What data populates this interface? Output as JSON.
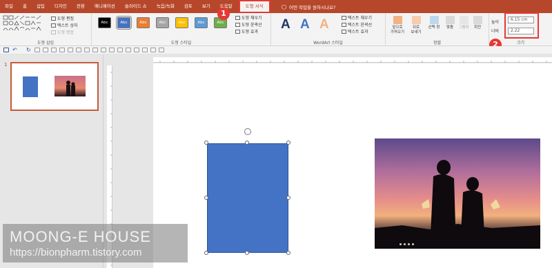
{
  "tabs": [
    "파일",
    "홈",
    "삽입",
    "디자인",
    "전환",
    "애니메이션",
    "슬라이드 쇼",
    "녹음/녹화",
    "검토",
    "보기",
    "도움말",
    "도형 서식"
  ],
  "active_tab": "도형 서식",
  "tell_me": "어떤 작업을 원하시나요?",
  "ribbon": {
    "insert_shapes": {
      "edit_shape": "도형 편집",
      "text_box": "텍스트 상자",
      "merge_shapes": "도형 병합",
      "label": "도형 삽입"
    },
    "shape_styles": {
      "preset_label": "Abc",
      "preset_colors": [
        "#000000",
        "#4472c4",
        "#ed7d31",
        "#a5a5a5",
        "#ffc000",
        "#5b9bd5",
        "#70ad47"
      ],
      "fill": "도형 채우기",
      "outline": "도형 윤곽선",
      "effects": "도형 효과",
      "label": "도형 스타일"
    },
    "wordart": {
      "letter": "A",
      "colors": [
        "#1f3864",
        "#4472c4",
        "#f4b183"
      ],
      "text_fill": "텍스트 채우기",
      "text_outline": "텍스트 윤곽선",
      "text_effects": "텍스트 효과",
      "label": "WordArt 스타일"
    },
    "arrange": {
      "bring_forward": "앞으로\n가져오기",
      "send_backward": "뒤로\n보내기",
      "selection_pane": "선택 창",
      "align": "맞춤",
      "group": "그룹화",
      "rotate": "회전",
      "label": "정렬"
    },
    "size": {
      "height_label": "높이",
      "height_value": "6.15 cm",
      "width_label": "너비",
      "width_value": "2.22",
      "label": "크기"
    }
  },
  "badges": [
    "1",
    "2"
  ],
  "slide_number": "1",
  "watermark": {
    "title": "MOONG-E HOUSE",
    "url": "https://bionpharm.tistory.com"
  },
  "colors": {
    "accent": "#b7472a",
    "highlight": "#e53935",
    "shape_fill": "#4472c4"
  }
}
